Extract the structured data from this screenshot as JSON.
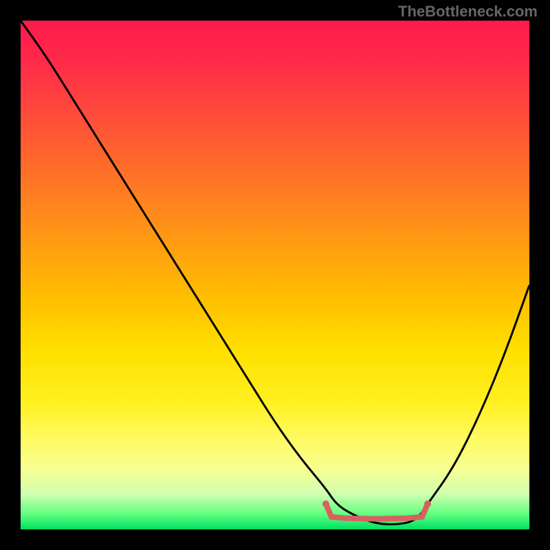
{
  "attribution": "TheBottleneck.com",
  "chart_data": {
    "type": "line",
    "title": "",
    "xlabel": "",
    "ylabel": "",
    "xlim": [
      0,
      100
    ],
    "ylim": [
      0,
      100
    ],
    "series": [
      {
        "name": "bottleneck-curve",
        "x": [
          0,
          5,
          10,
          15,
          20,
          25,
          30,
          35,
          40,
          45,
          50,
          55,
          60,
          62,
          65,
          70,
          75,
          78,
          80,
          85,
          90,
          95,
          100
        ],
        "y": [
          100,
          93,
          85,
          77,
          69,
          61,
          53,
          45,
          37,
          29,
          21,
          14,
          8,
          5,
          3,
          1,
          1,
          2,
          5,
          12,
          22,
          34,
          48
        ]
      }
    ],
    "optimal_range": {
      "x_start": 60,
      "x_end": 80,
      "y": 3
    },
    "gradient_colors": {
      "top": "#ff1a4d",
      "mid": "#ffe000",
      "bottom": "#00e060"
    }
  }
}
